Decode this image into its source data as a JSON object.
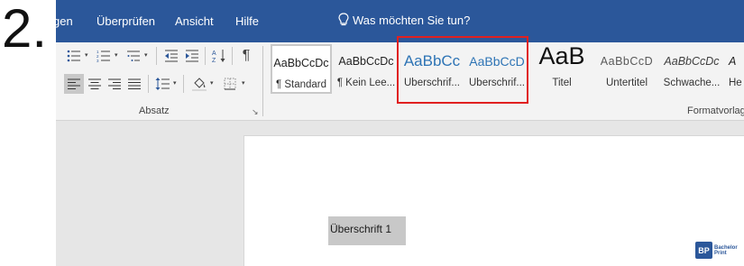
{
  "step_number": "2.",
  "ribbon": {
    "tabs": [
      "gen",
      "Überprüfen",
      "Ansicht",
      "Hilfe"
    ],
    "tell_me": "Was möchten Sie tun?"
  },
  "paragraph_group": {
    "label": "Absatz"
  },
  "styles_group": {
    "label": "Formatvorlag",
    "items": [
      {
        "preview": "AaBbCcDc",
        "name": "¶ Standard"
      },
      {
        "preview": "AaBbCcDc",
        "name": "¶ Kein Lee..."
      },
      {
        "preview": "AaBbCc",
        "name": "Überschrif..."
      },
      {
        "preview": "AaBbCcD",
        "name": "Überschrif..."
      },
      {
        "preview": "AaB",
        "name": "Titel"
      },
      {
        "preview": "AaBbCcD",
        "name": "Untertitel"
      },
      {
        "preview": "AaBbCcDc",
        "name": "Schwache..."
      },
      {
        "preview": "A",
        "name": "He"
      }
    ]
  },
  "document": {
    "heading_text": "Überschrift 1"
  },
  "logo": {
    "line1": "Bachelor",
    "line2": "Print"
  },
  "colors": {
    "ribbon_blue": "#2b579a",
    "highlight_red": "#e02020",
    "heading_blue": "#2e74b5"
  }
}
